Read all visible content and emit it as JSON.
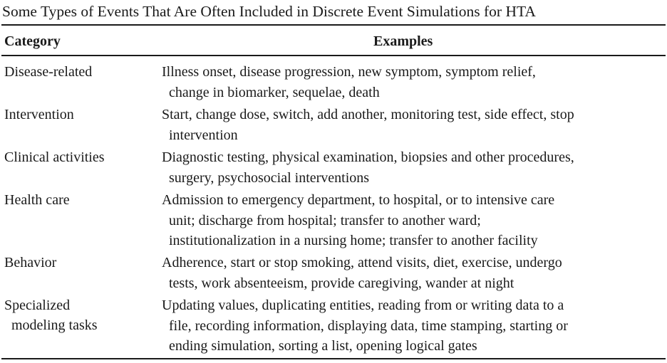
{
  "caption": "Some Types of Events That Are Often Included in Discrete Event Simulations for HTA",
  "header": {
    "category": "Category",
    "examples": "Examples"
  },
  "rows": [
    {
      "category": [
        "Disease-related"
      ],
      "examples": [
        "Illness onset, disease progression, new symptom, symptom relief,",
        "change in biomarker, sequelae, death"
      ]
    },
    {
      "category": [
        "Intervention"
      ],
      "examples": [
        "Start, change dose, switch, add another, monitoring test, side effect, stop",
        "intervention"
      ]
    },
    {
      "category": [
        "Clinical activities"
      ],
      "examples": [
        "Diagnostic testing, physical examination, biopsies and other procedures,",
        "surgery, psychosocial interventions"
      ]
    },
    {
      "category": [
        "Health care"
      ],
      "examples": [
        "Admission to emergency department, to hospital, or to intensive care",
        "unit; discharge from hospital; transfer to another ward;",
        "institutionalization in a nursing home; transfer to another facility"
      ]
    },
    {
      "category": [
        "Behavior"
      ],
      "examples": [
        "Adherence, start or stop smoking, attend visits, diet, exercise, undergo",
        "tests, work absenteeism, provide caregiving, wander at night"
      ]
    },
    {
      "category": [
        "Specialized",
        "modeling tasks"
      ],
      "examples": [
        "Updating values, duplicating entities, reading from or writing data to a",
        "file, recording information, displaying data, time stamping, starting or",
        "ending simulation, sorting a list, opening logical gates"
      ]
    }
  ]
}
